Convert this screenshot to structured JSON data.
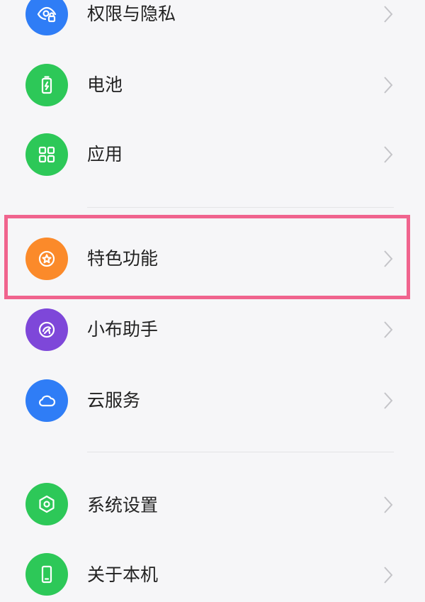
{
  "settings": {
    "items": [
      {
        "label": "权限与隐私",
        "icon": "privacy-eye-icon",
        "color": "#2f7df6"
      },
      {
        "label": "电池",
        "icon": "battery-icon",
        "color": "#2dc858"
      },
      {
        "label": "应用",
        "icon": "apps-grid-icon",
        "color": "#2dc858"
      },
      {
        "label": "特色功能",
        "icon": "star-badge-icon",
        "color": "#fb8a2a"
      },
      {
        "label": "小布助手",
        "icon": "assistant-icon",
        "color": "#7e47d9"
      },
      {
        "label": "云服务",
        "icon": "cloud-icon",
        "color": "#2f7df6"
      },
      {
        "label": "系统设置",
        "icon": "hexagon-settings-icon",
        "color": "#2dc858"
      },
      {
        "label": "关于本机",
        "icon": "phone-icon",
        "color": "#2dc858"
      }
    ],
    "highlight_color": "#f0648e"
  }
}
